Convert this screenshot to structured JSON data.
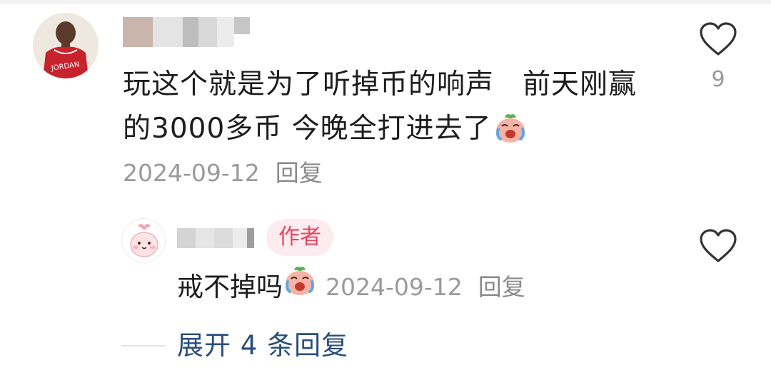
{
  "comment": {
    "text_line1": "玩这个就是为了听掉币的响声",
    "text_line1b": "前天刚赢",
    "text_line2": "的3000多币 今晚全打进去了",
    "emoji": "crying-laughing-peach-emoji",
    "date": "2024-09-12",
    "reply_label": "回复",
    "like_count": "9",
    "avatar_jersey_text": "JORDAN"
  },
  "reply": {
    "author_badge": "作者",
    "text": "戒不掉吗",
    "emoji": "crying-laughing-peach-emoji",
    "date": "2024-09-12",
    "reply_label": "回复"
  },
  "expand": {
    "label": "展开 4 条回复"
  },
  "colors": {
    "badge_bg": "#fdecef",
    "badge_text": "#e8455f",
    "expand_text": "#2a4e7c",
    "meta_text": "#9a9a9a"
  }
}
